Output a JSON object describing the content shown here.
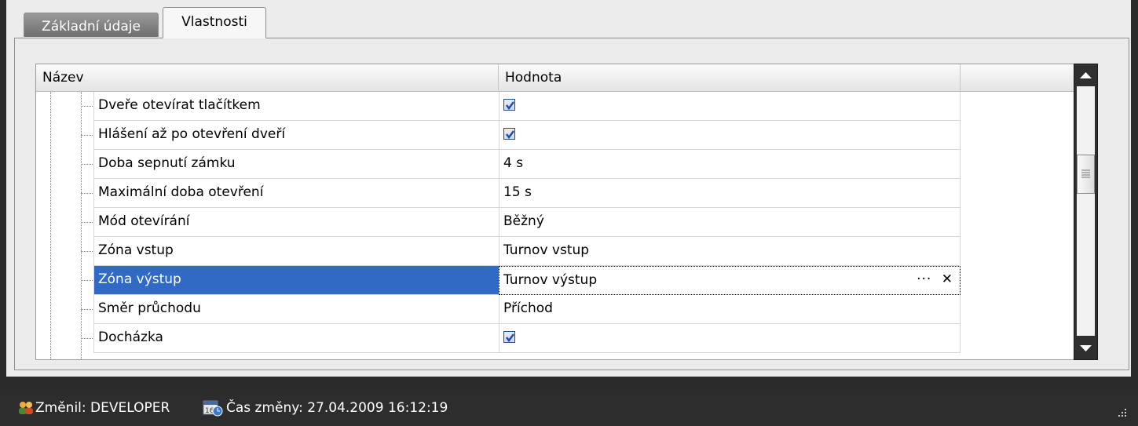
{
  "tabs": [
    {
      "label": "Základní údaje"
    },
    {
      "label": "Vlastnosti"
    }
  ],
  "grid": {
    "columns": [
      "Název",
      "Hodnota"
    ],
    "rows": [
      {
        "name": "Dveře otevírat tlačítkem",
        "value": "",
        "checked": true
      },
      {
        "name": "Hlášení až po otevření dveří",
        "value": "",
        "checked": true
      },
      {
        "name": "Doba sepnutí zámku",
        "value": "4 s"
      },
      {
        "name": "Maximální doba otevření",
        "value": "15 s"
      },
      {
        "name": "Mód otevírání",
        "value": "Běžný"
      },
      {
        "name": "Zóna vstup",
        "value": "Turnov vstup"
      },
      {
        "name": "Zóna výstup",
        "value": "Turnov výstup",
        "selected": true
      },
      {
        "name": "Směr průchodu",
        "value": "Příchod"
      },
      {
        "name": "Docházka",
        "value": "",
        "checked": true
      }
    ],
    "edit_buttons": {
      "browse": "···",
      "clear": "✕"
    }
  },
  "statusbar": {
    "changed_by": "Změnil: DEVELOPER",
    "changed_time": "Čas změny: 27.04.2009 16:12:19"
  },
  "icons": {
    "user_icon": "users-icon",
    "time_icon": "calendar-clock-icon",
    "checkbox_checked": "checkmark-icon",
    "scroll_up": "arrow-up-icon",
    "scroll_down": "arrow-down-icon",
    "resize_grip": "resize-grip-icon"
  },
  "colors": {
    "selection": "#316ac5",
    "statusbar_bg": "#2d2d2d"
  }
}
